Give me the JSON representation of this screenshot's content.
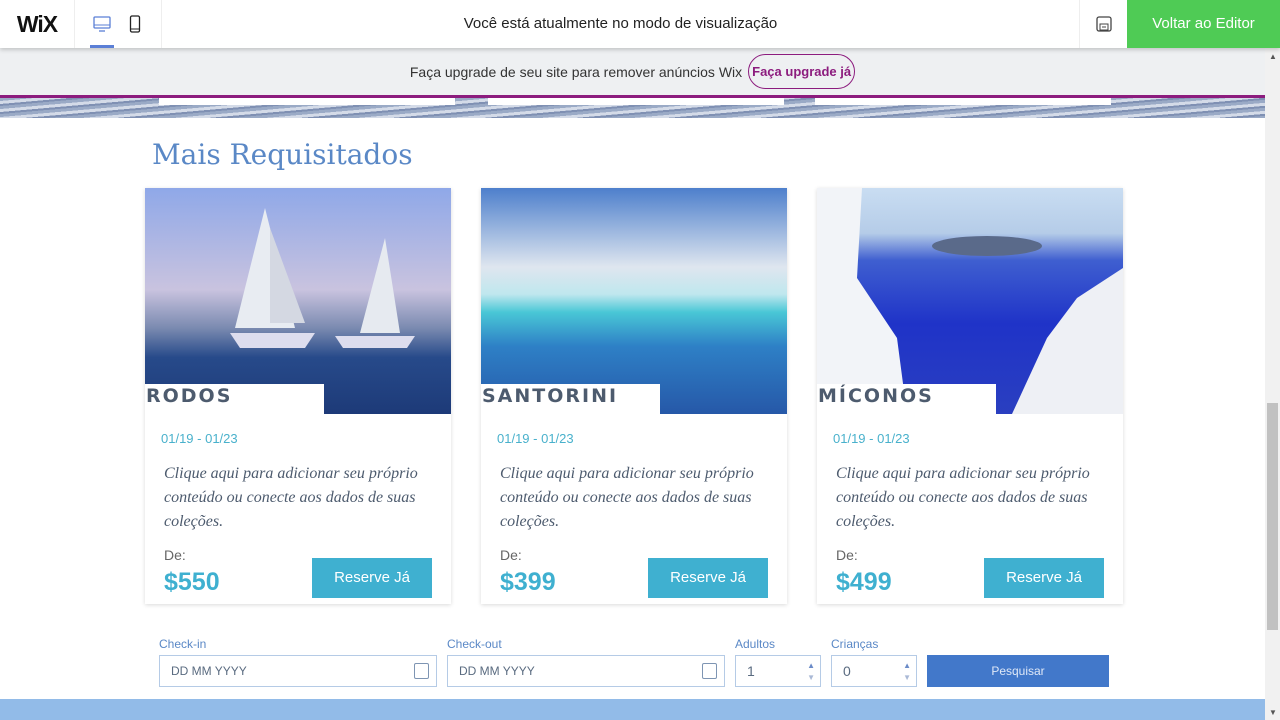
{
  "topbar": {
    "logo": "WiX",
    "message": "Você está atualmente no modo de visualização",
    "back_button": "Voltar ao Editor"
  },
  "promo": {
    "text": "Faça upgrade de seu site para remover anúncios Wix",
    "button": "Faça upgrade já"
  },
  "section": {
    "heading": "Mais Requisitados"
  },
  "cards": [
    {
      "name": "RODOS",
      "dates": "01/19 - 01/23",
      "description": "Clique aqui para adicionar seu próprio conteúdo ou conecte aos dados de suas coleções.",
      "from_label": "De:",
      "price": "$550",
      "button": "Reserve Já"
    },
    {
      "name": "SANTORINI",
      "dates": "01/19 - 01/23",
      "description": "Clique aqui para adicionar seu próprio conteúdo ou conecte aos dados de suas coleções.",
      "from_label": "De:",
      "price": "$399",
      "button": "Reserve Já"
    },
    {
      "name": "MÍCONOS",
      "dates": "01/19 - 01/23",
      "description": "Clique aqui para adicionar seu próprio conteúdo ou conecte aos dados de suas coleções.",
      "from_label": "De:",
      "price": "$499",
      "button": "Reserve Já"
    }
  ],
  "booking": {
    "checkin_label": "Check-in",
    "checkin_placeholder": "DD MM YYYY",
    "checkout_label": "Check-out",
    "checkout_placeholder": "DD MM YYYY",
    "adults_label": "Adultos",
    "adults_value": "1",
    "children_label": "Crianças",
    "children_value": "0",
    "search_button": "Pesquisar"
  }
}
